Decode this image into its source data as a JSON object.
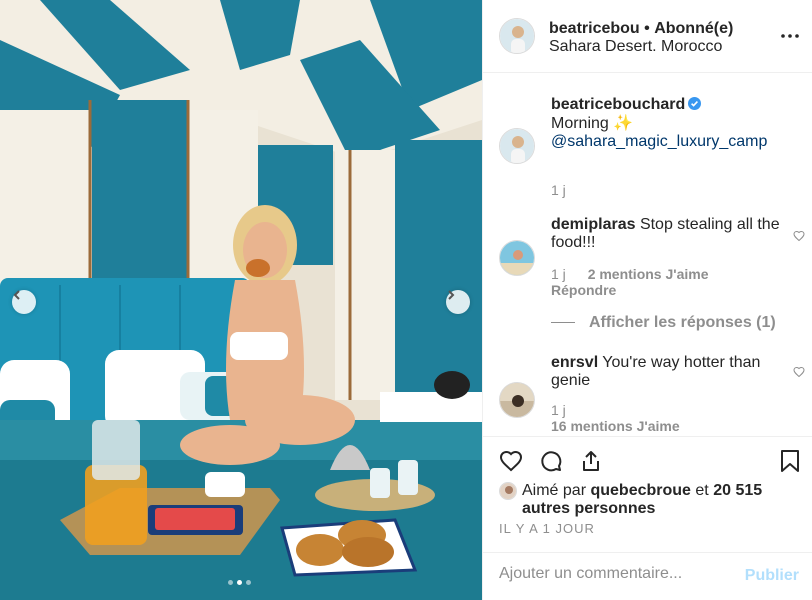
{
  "post": {
    "username": "beatricebou",
    "separator": "•",
    "follow_status": "Abonné(e)",
    "location": "Sahara Desert. Morocco"
  },
  "caption": {
    "username": "beatricebouchard",
    "text": "Morning ✨",
    "mention": "@sahara_magic_luxury_camp",
    "time": "1 j"
  },
  "comments": [
    {
      "username": "demiplaras",
      "text": "Stop stealing all the food!!!",
      "time": "1 j",
      "likes": "2 mentions J'aime",
      "reply": "Répondre",
      "view_replies": "Afficher les réponses (1)"
    },
    {
      "username": "enrsvl",
      "text": "You're way hotter than genie",
      "time": "1 j",
      "likes": "16 mentions J'aime"
    }
  ],
  "likes": {
    "prefix": "Aimé par",
    "user": "quebecbroue",
    "connector": "et",
    "count": "20 515 autres personnes"
  },
  "timestamp": "IL Y A 1 JOUR",
  "add_comment": {
    "placeholder": "Ajouter un commentaire...",
    "publish": "Publier"
  },
  "carousel": {
    "count": 3,
    "active": 2
  },
  "colors": {
    "verified": "#3897f0",
    "link": "#00376b",
    "muted": "#8e8e8e",
    "publish_disabled": "#b2dffc"
  }
}
